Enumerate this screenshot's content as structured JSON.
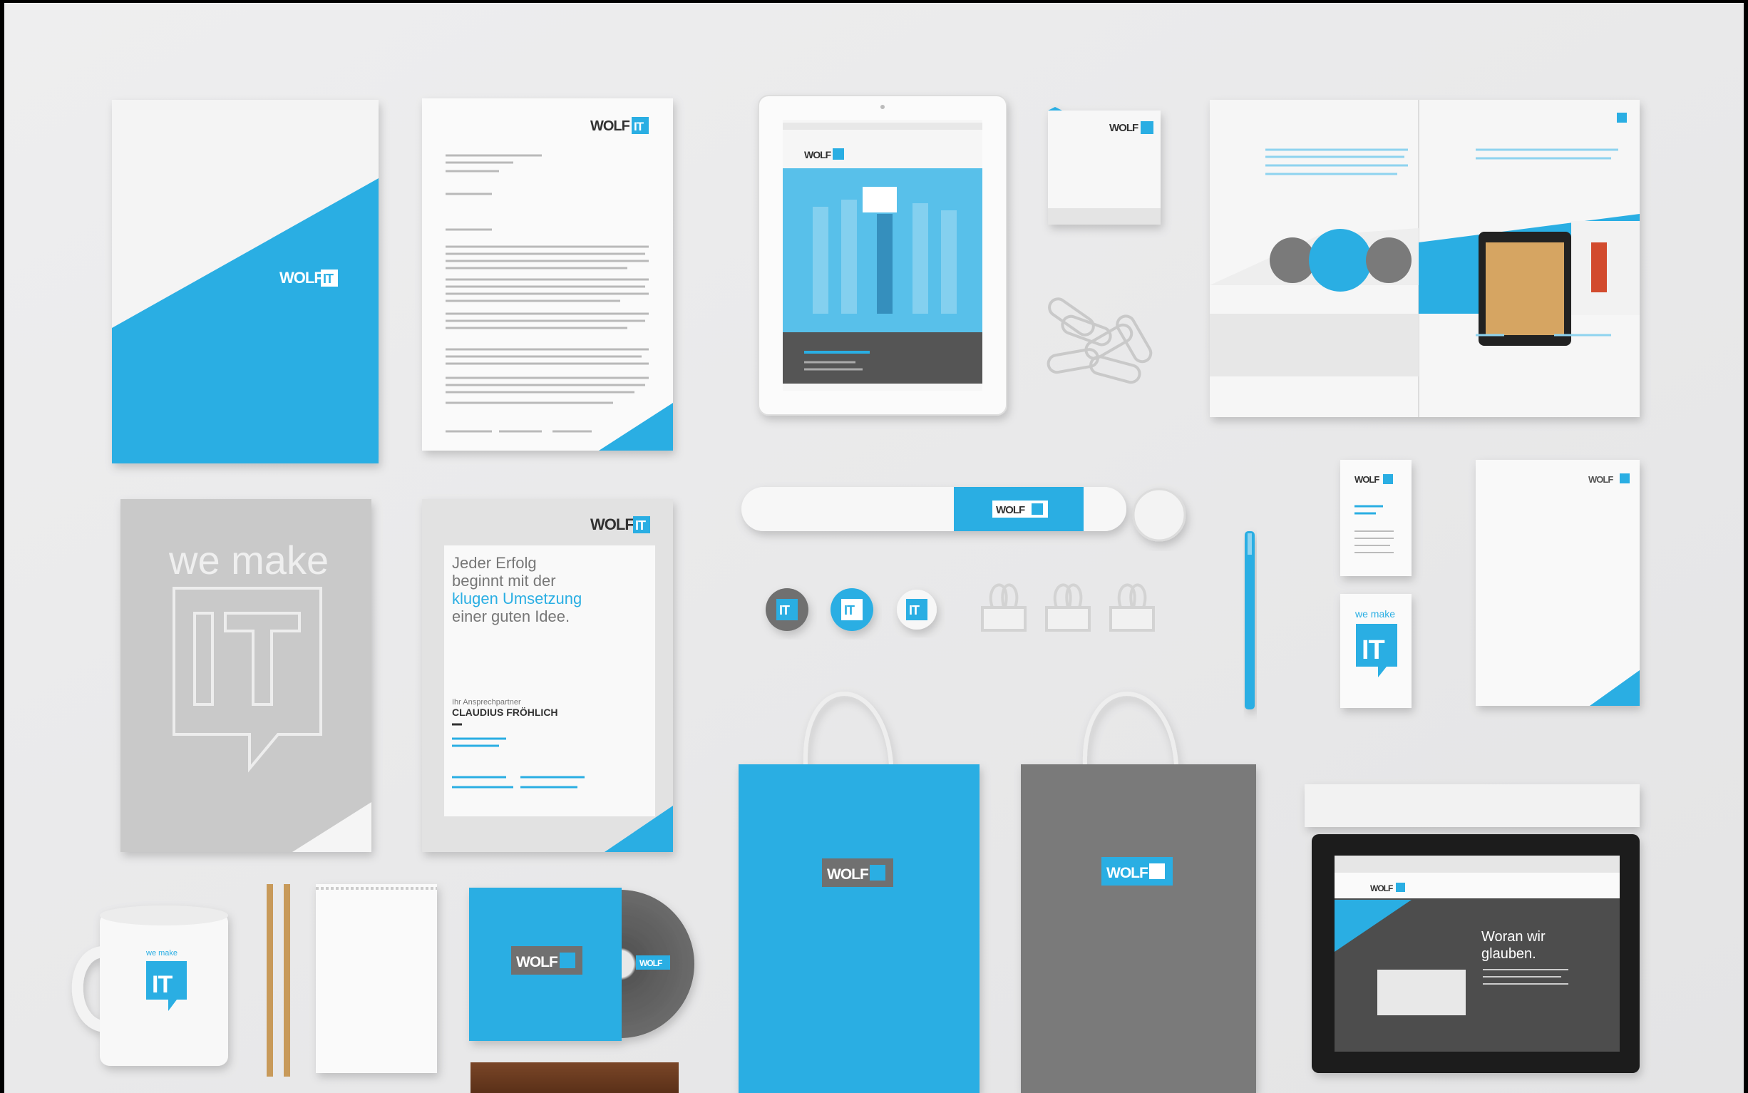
{
  "brand": {
    "name": "WOLF",
    "mark": "IT",
    "accent_color": "#29aee3",
    "gray_color": "#7a7a7a",
    "background_color": "#e9e9ea"
  },
  "folder_poster": {
    "slogan": "we make"
  },
  "flyer": {
    "headline": [
      "Jeder Erfolg",
      "beginnt mit der"
    ],
    "headline_accent": "klugen Umsetzung",
    "headline_end": "einer guten Idee.",
    "contact_role": "Ihr Ansprechpartner",
    "contact_name": "CLAUDIUS FRÖHLICH"
  },
  "pin_buttons": [
    "IT",
    "IT",
    "IT"
  ],
  "business_card": {
    "slogan": "we make"
  },
  "laptop_site": {
    "headline": [
      "Woran wir",
      "glauben."
    ]
  }
}
